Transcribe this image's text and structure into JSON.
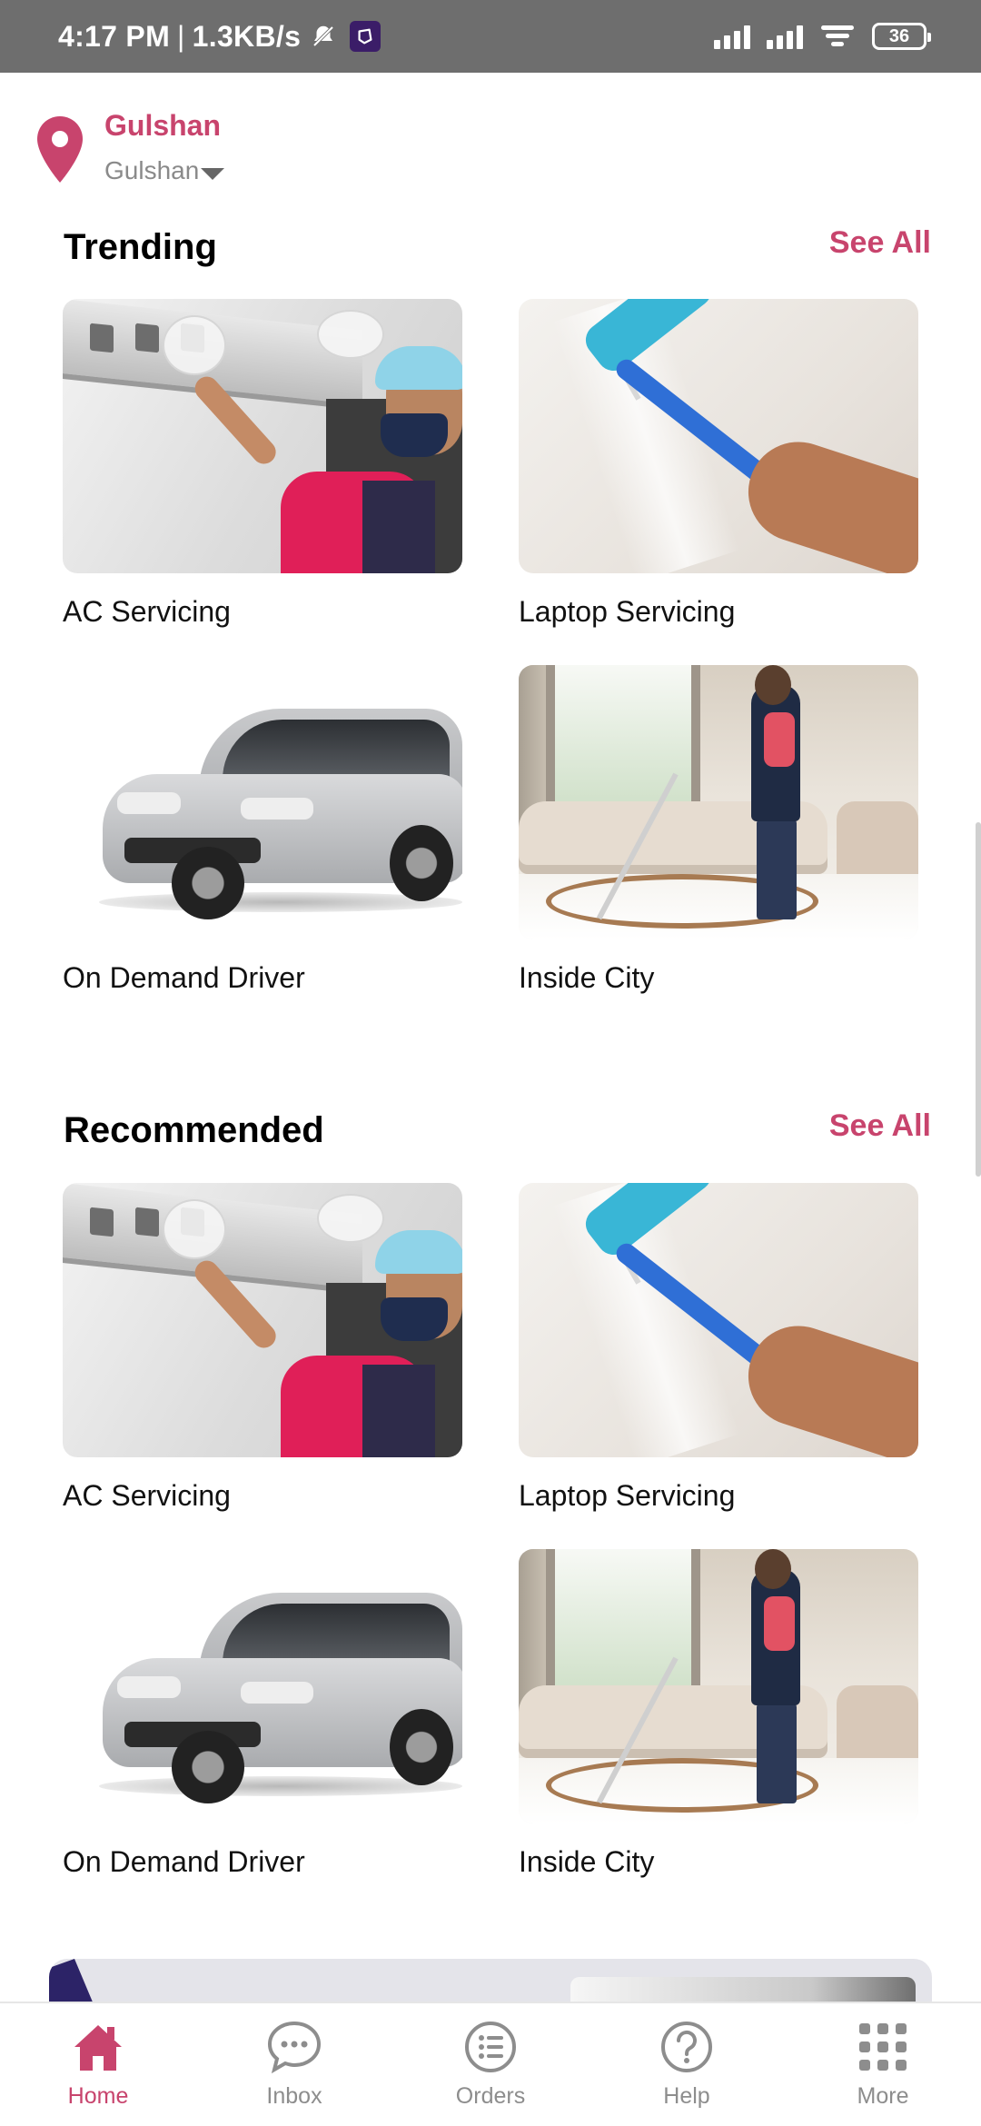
{
  "status_bar": {
    "time": "4:17 PM",
    "separator": "|",
    "speed": "1.3KB/s",
    "battery": "36"
  },
  "location": {
    "title": "Gulshan",
    "subtitle": "Gulshan"
  },
  "sections": [
    {
      "title": "Trending",
      "see_all": "See All",
      "items": [
        {
          "label": "AC Servicing",
          "image": "ac-servicing"
        },
        {
          "label": "Laptop Servicing",
          "image": "painting"
        },
        {
          "label": "On Demand Driver",
          "image": "car"
        },
        {
          "label": "Inside City",
          "image": "cleaning"
        }
      ]
    },
    {
      "title": "Recommended",
      "see_all": "See All",
      "items": [
        {
          "label": "AC Servicing",
          "image": "ac-servicing"
        },
        {
          "label": "Laptop Servicing",
          "image": "painting"
        },
        {
          "label": "On Demand Driver",
          "image": "car"
        },
        {
          "label": "Inside City",
          "image": "cleaning"
        }
      ]
    }
  ],
  "bottom_nav": [
    {
      "label": "Home",
      "icon": "home-icon",
      "active": true
    },
    {
      "label": "Inbox",
      "icon": "chat-icon",
      "active": false
    },
    {
      "label": "Orders",
      "icon": "list-icon",
      "active": false
    },
    {
      "label": "Help",
      "icon": "help-icon",
      "active": false
    },
    {
      "label": "More",
      "icon": "grid-icon",
      "active": false
    }
  ],
  "colors": {
    "accent": "#c8446d",
    "status_bar": "#6e6e6e",
    "nav_inactive": "#8d8d8d"
  }
}
